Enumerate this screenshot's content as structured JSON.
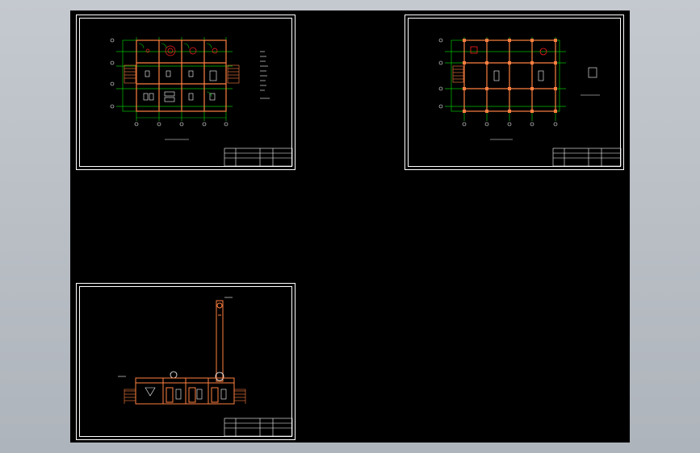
{
  "viewer": {
    "background_color": "#000000",
    "frame_color": "#b9bfc6"
  },
  "colors": {
    "border": "#ffffff",
    "wall": "#ff8040",
    "grid": "#00c000",
    "axis_bubble": "#ffffff",
    "red": "#ff2020"
  },
  "sheets": [
    {
      "id": "sheet-1",
      "title": "",
      "kind": "floor-plan"
    },
    {
      "id": "sheet-2",
      "title": "",
      "kind": "structure-plan"
    },
    {
      "id": "sheet-3",
      "title": "",
      "kind": "elevation"
    }
  ],
  "icons": {
    "stair": "stair-icon",
    "axis": "axis-bubble-icon",
    "door": "door-icon"
  }
}
